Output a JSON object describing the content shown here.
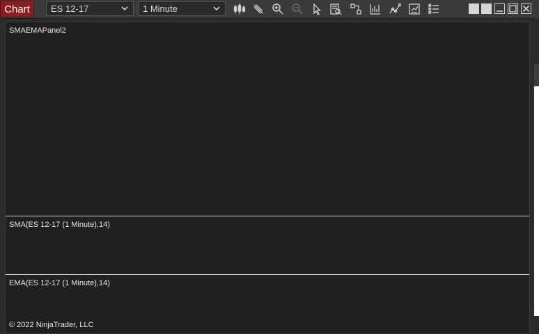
{
  "toolbar": {
    "chart_label": "Chart",
    "instrument": "ES 12-17",
    "interval": "1 Minute",
    "icons": [
      "bar-type-icon",
      "drawing-tool-icon",
      "zoom-in-icon",
      "zoom-out-icon",
      "pointer-icon",
      "data-box-icon",
      "properties-icon",
      "indicators-icon",
      "strategies-icon",
      "chart-trader-icon",
      "list-icon"
    ]
  },
  "window_controls": [
    "tile-left-button",
    "tile-right-button",
    "minimize-button",
    "maximize-button",
    "close-button"
  ],
  "panels": {
    "main_label": "SMAEMAPanel2",
    "sma_label": "SMA(ES 12-17 (1 Minute),14)",
    "ema_label": "EMA(ES 12-17 (1 Minute),14)"
  },
  "copyright": "© 2022 NinjaTrader, LLC",
  "colors": {
    "chart_tab": "#8c1d23",
    "toolbar": "#3a3a3a",
    "panel_bg": "#202020",
    "separator": "#cfcfcf"
  }
}
